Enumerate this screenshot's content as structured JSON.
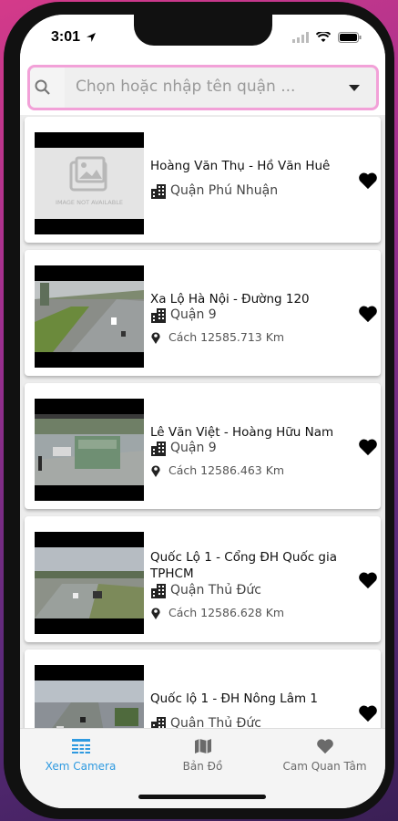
{
  "status": {
    "time": "3:01"
  },
  "search": {
    "placeholder": "Chọn hoặc nhập tên quận ..."
  },
  "cameras": [
    {
      "title": "Hoàng Văn Thụ - Hồ Văn Huê",
      "district": "Quận Phú Nhuận",
      "distance": "",
      "image": "not-available",
      "image_text": "IMAGE NOT AVAILABLE"
    },
    {
      "title": "Xa Lộ Hà Nội - Đường 120",
      "district": "Quận 9",
      "distance": "Cách 12585.713 Km",
      "image": "road-feed"
    },
    {
      "title": "Lê Văn Việt - Hoàng Hữu Nam",
      "district": "Quận 9",
      "distance": "Cách 12586.463 Km",
      "image": "street-feed"
    },
    {
      "title": "Quốc Lộ 1 - Cổng ĐH Quốc gia TPHCM",
      "district": "Quận Thủ Đức",
      "distance": "Cách 12586.628 Km",
      "image": "highway-feed"
    },
    {
      "title": "Quốc lộ 1 - ĐH Nông Lâm 1",
      "district": "Quận Thủ Đức",
      "distance": "",
      "image": "highway-feed-2"
    }
  ],
  "nav": [
    {
      "label": "Xem Camera",
      "icon": "camera-list-icon",
      "active": true
    },
    {
      "label": "Bản Đồ",
      "icon": "map-icon",
      "active": false
    },
    {
      "label": "Cam Quan Tâm",
      "icon": "heart-icon",
      "active": false
    }
  ],
  "colors": {
    "accent": "#2f9ae0",
    "search_border": "#f2a1d8",
    "inactive": "#6a6a6a"
  }
}
